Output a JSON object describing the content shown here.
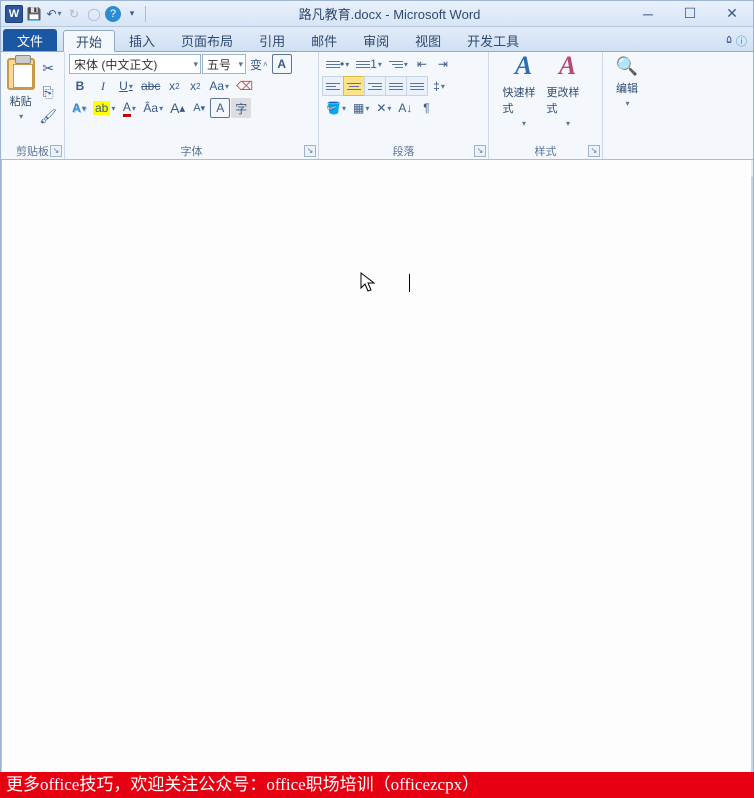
{
  "title": "路凡教育.docx - Microsoft Word",
  "tabs": {
    "file": "文件",
    "home": "开始",
    "insert": "插入",
    "layout": "页面布局",
    "ref": "引用",
    "mail": "邮件",
    "review": "审阅",
    "view": "视图",
    "dev": "开发工具"
  },
  "groups": {
    "clipboard": "剪贴板",
    "font": "字体",
    "paragraph": "段落",
    "styles": "样式",
    "editing": "编辑"
  },
  "clipboard": {
    "paste": "粘贴"
  },
  "font": {
    "name": "宋体 (中文正文)",
    "size": "五号"
  },
  "styles": {
    "quick": "快速样式",
    "change": "更改样式"
  },
  "banner": "更多office技巧，欢迎关注公众号：office职场培训（officezcpx）"
}
